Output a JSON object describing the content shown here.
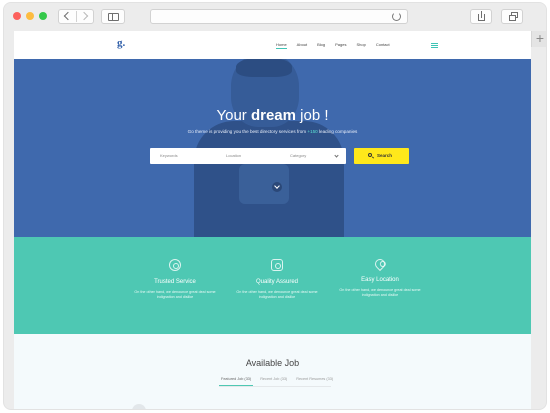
{
  "site": {
    "logo": "g.",
    "nav": [
      "Home",
      "About",
      "Blog",
      "Pages",
      "Shop",
      "Contact"
    ]
  },
  "hero": {
    "title_pre": "Your ",
    "title_bold": "dream",
    "title_post": " job !",
    "subtitle_pre": "Go theme is providing you the best directory services from ",
    "subtitle_highlight": "+150",
    "subtitle_post": " leading companies",
    "search": {
      "keywords_placeholder": "Keywords",
      "location_placeholder": "Location",
      "category_placeholder": "Category",
      "button": "Search"
    }
  },
  "features": [
    {
      "icon": "shield-icon",
      "title": "Trusted Service",
      "text": "On the other hand, we denounce great deal some indignation and dislike"
    },
    {
      "icon": "badge-check-icon",
      "title": "Quality Assured",
      "text": "On the other hand, we denounce great deal some indignation and dislike"
    },
    {
      "icon": "location-pin-icon",
      "title": "Easy Location",
      "text": "On the other hand, we denounce great deal some indignation and dislike"
    }
  ],
  "jobs": {
    "title": "Available Job",
    "tabs": [
      "Featured Job (33)",
      "Recent Job (33)",
      "Recent Resumes (33)"
    ]
  },
  "colors": {
    "hero_blue": "#3f69ad",
    "teal": "#4ec8b3",
    "search_yellow": "#ffe81b",
    "accent": "#5ce1d2"
  }
}
